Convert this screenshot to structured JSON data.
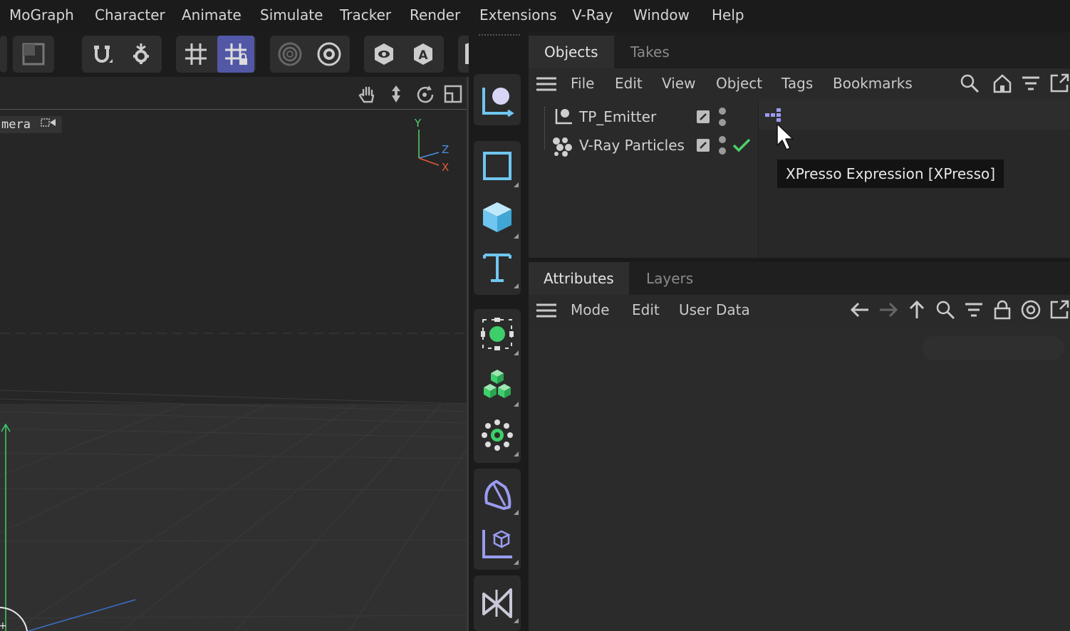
{
  "menubar": {
    "items": [
      "MoGraph",
      "Character",
      "Animate",
      "Simulate",
      "Tracker",
      "Render",
      "Extensions",
      "V-Ray",
      "Window",
      "Help"
    ]
  },
  "viewport": {
    "camera_label": "mera",
    "axis_y": "Y",
    "axis_z": "Z",
    "axis_x": "X"
  },
  "objects_panel": {
    "tabs": [
      "Objects",
      "Takes"
    ],
    "menu": [
      "File",
      "Edit",
      "View",
      "Object",
      "Tags",
      "Bookmarks"
    ],
    "rows": [
      {
        "name": "TP_Emitter",
        "icon": "emitter-icon"
      },
      {
        "name": "V-Ray Particles",
        "icon": "particles-icon"
      }
    ],
    "tooltip": "XPresso Expression [XPresso]"
  },
  "attributes_panel": {
    "tabs": [
      "Attributes",
      "Layers"
    ],
    "menu": [
      "Mode",
      "Edit",
      "User Data"
    ]
  },
  "colors": {
    "accent": "#5258a6",
    "palette_blue": "#6fc6f0",
    "palette_green": "#3ecf6a",
    "palette_purple": "#9a9cf0",
    "check_green": "#4bd06a",
    "axis_y": "#56d36b",
    "axis_z": "#4a90e2",
    "axis_x": "#e05a3a"
  }
}
